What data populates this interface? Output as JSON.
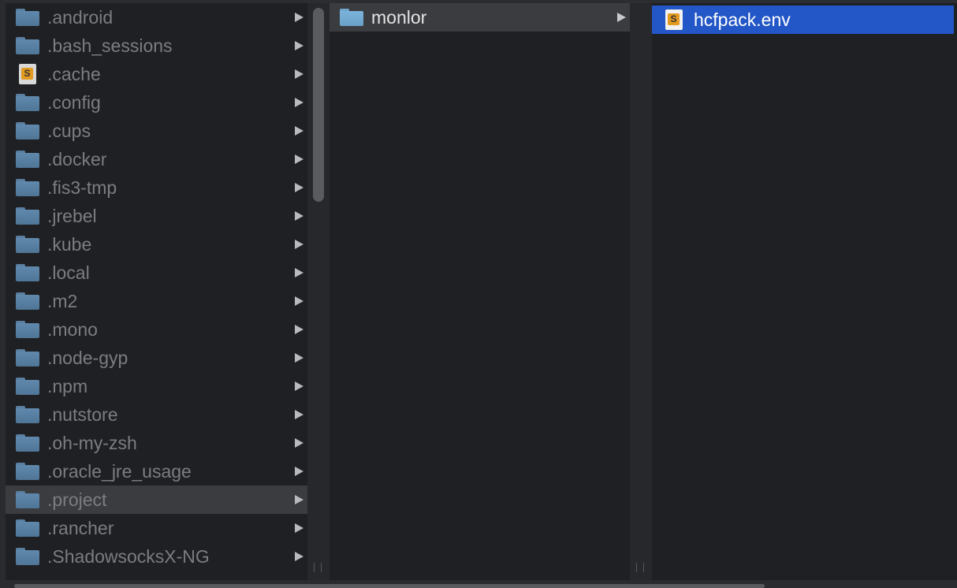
{
  "columns": {
    "col1": {
      "items": [
        {
          "label": ".android",
          "icon": "folder-icon"
        },
        {
          "label": ".bash_sessions",
          "icon": "folder-icon"
        },
        {
          "label": ".cache",
          "icon": "sublime-file-icon"
        },
        {
          "label": ".config",
          "icon": "folder-icon"
        },
        {
          "label": ".cups",
          "icon": "folder-icon"
        },
        {
          "label": ".docker",
          "icon": "folder-icon"
        },
        {
          "label": ".fis3-tmp",
          "icon": "folder-icon"
        },
        {
          "label": ".jrebel",
          "icon": "folder-icon"
        },
        {
          "label": ".kube",
          "icon": "folder-icon"
        },
        {
          "label": ".local",
          "icon": "folder-icon"
        },
        {
          "label": ".m2",
          "icon": "folder-icon"
        },
        {
          "label": ".mono",
          "icon": "folder-icon"
        },
        {
          "label": ".node-gyp",
          "icon": "folder-icon"
        },
        {
          "label": ".npm",
          "icon": "folder-icon"
        },
        {
          "label": ".nutstore",
          "icon": "folder-icon"
        },
        {
          "label": ".oh-my-zsh",
          "icon": "folder-icon"
        },
        {
          "label": ".oracle_jre_usage",
          "icon": "folder-icon"
        },
        {
          "label": ".project",
          "icon": "folder-icon",
          "selected": true
        },
        {
          "label": ".rancher",
          "icon": "folder-icon"
        },
        {
          "label": ".ShadowsocksX-NG",
          "icon": "folder-icon"
        }
      ]
    },
    "col2": {
      "items": [
        {
          "label": "monlor",
          "icon": "folder-icon",
          "selected": true
        }
      ]
    },
    "col3": {
      "items": [
        {
          "label": "hcfpack.env",
          "icon": "sublime-file-icon",
          "selected": true
        }
      ]
    }
  },
  "colors": {
    "background": "#1f2023",
    "selection_inactive": "#3b3c3f",
    "selection_active": "#2356c6",
    "folder": "#5f89ad"
  },
  "icons": {
    "file_badge_glyph": "S"
  }
}
